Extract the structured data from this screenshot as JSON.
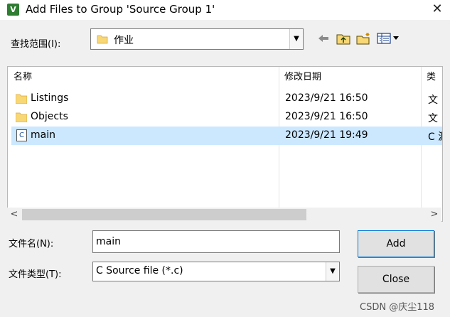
{
  "window": {
    "title": "Add Files to Group 'Source Group 1'",
    "app_icon_letter": "V",
    "close_glyph": "✕"
  },
  "lookin": {
    "label": "查找范围(I):",
    "value": "作业",
    "icons": [
      "back-icon",
      "up-folder-icon",
      "new-folder-icon",
      "view-menu-icon"
    ]
  },
  "list": {
    "columns": [
      "名称",
      "修改日期",
      "类"
    ],
    "rows": [
      {
        "name": "Listings",
        "date": "2023/9/21 16:50",
        "type": "文",
        "icon": "folder-icon",
        "selected": false
      },
      {
        "name": "Objects",
        "date": "2023/9/21 16:50",
        "type": "文",
        "icon": "folder-icon",
        "selected": false
      },
      {
        "name": "main",
        "date": "2023/9/21 19:49",
        "type": "C 源",
        "icon": "c-file-icon",
        "selected": true
      }
    ]
  },
  "fields": {
    "filename_label": "文件名(N):",
    "filename_value": "main",
    "filetype_label": "文件类型(T):",
    "filetype_value": "C Source file (*.c)"
  },
  "buttons": {
    "add": "Add",
    "close": "Close"
  },
  "watermark": "CSDN @庆尘118",
  "colors": {
    "selection": "#cce8ff",
    "folder": "#f8d775",
    "accent": "#0078d7"
  }
}
